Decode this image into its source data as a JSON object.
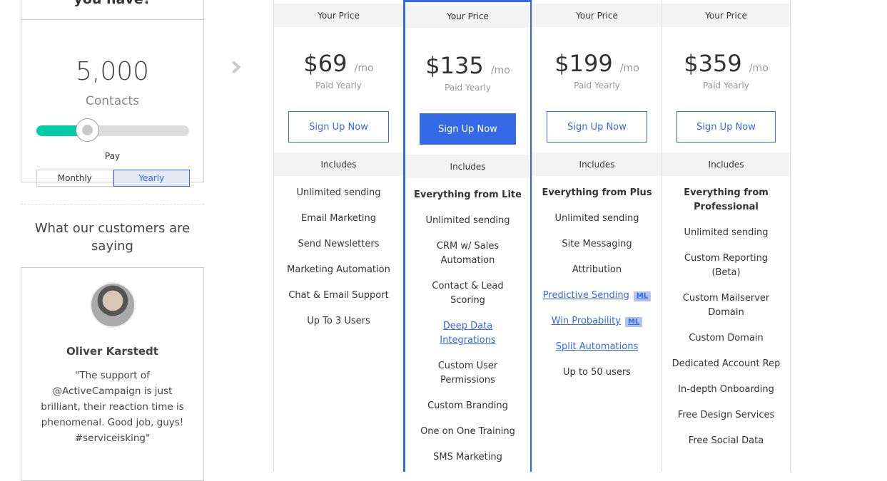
{
  "contacts": {
    "question": "you have?",
    "value": "5,000",
    "label": "Contacts",
    "slider_fraction": 0.33,
    "pay_label": "Pay",
    "options": [
      "Monthly",
      "Yearly"
    ],
    "selected": "Yearly"
  },
  "testimonials": {
    "heading": "What our customers are saying",
    "name": "Oliver Karstedt",
    "quote": "\"The support of @ActiveCampaign is just brilliant, their reaction time is phenomenal. Good job, guys! #serviceisking\""
  },
  "accent": "#356ae6",
  "plans": [
    {
      "your_price": "Your Price",
      "price": "$69",
      "per": "/mo",
      "billing": "Paid Yearly",
      "cta": "Sign Up Now",
      "includes": "Includes",
      "features": [
        {
          "t": "Unlimited sending"
        },
        {
          "t": "Email Marketing"
        },
        {
          "t": "Send Newsletters"
        },
        {
          "t": "Marketing Automation"
        },
        {
          "t": "Chat & Email Support"
        },
        {
          "t": "Up To 3 Users"
        }
      ]
    },
    {
      "your_price": "Your Price",
      "price": "$135",
      "per": "/mo",
      "billing": "Paid Yearly",
      "cta": "Sign Up Now",
      "includes": "Includes",
      "features": [
        {
          "t": "Everything from Lite",
          "bold": true
        },
        {
          "t": "Unlimited sending"
        },
        {
          "t": "CRM w/ Sales Automation"
        },
        {
          "t": "Contact & Lead Scoring"
        },
        {
          "t": "Deep Data Integrations",
          "link": true
        },
        {
          "t": "Custom User Permissions"
        },
        {
          "t": "Custom Branding"
        },
        {
          "t": "One on One Training"
        },
        {
          "t": "SMS Marketing"
        }
      ]
    },
    {
      "your_price": "Your Price",
      "price": "$199",
      "per": "/mo",
      "billing": "Paid Yearly",
      "cta": "Sign Up Now",
      "includes": "Includes",
      "features": [
        {
          "t": "Everything from Plus",
          "bold": true
        },
        {
          "t": "Unlimited sending"
        },
        {
          "t": "Site Messaging"
        },
        {
          "t": "Attribution"
        },
        {
          "t": "Predictive Sending",
          "link": true,
          "badge": "ML"
        },
        {
          "t": "Win Probability",
          "link": true,
          "badge": "ML"
        },
        {
          "t": "Split Automations",
          "link": true
        },
        {
          "t": "Up to 50 users"
        }
      ]
    },
    {
      "your_price": "Your Price",
      "price": "$359",
      "per": "/mo",
      "billing": "Paid Yearly",
      "cta": "Sign Up Now",
      "includes": "Includes",
      "features": [
        {
          "t": "Everything from Professional",
          "bold": true
        },
        {
          "t": "Unlimited sending"
        },
        {
          "t": "Custom Reporting (Beta)"
        },
        {
          "t": "Custom Mailserver Domain"
        },
        {
          "t": "Custom Domain"
        },
        {
          "t": "Dedicated Account Rep"
        },
        {
          "t": "In-depth Onboarding"
        },
        {
          "t": "Free Design Services"
        },
        {
          "t": "Free Social Data"
        }
      ]
    }
  ]
}
